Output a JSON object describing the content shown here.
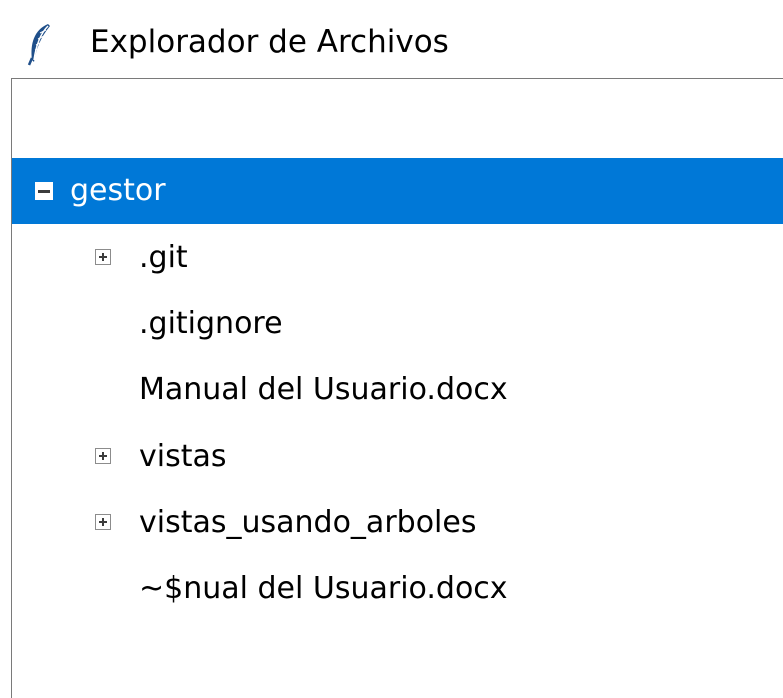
{
  "window": {
    "title": "Explorador de Archivos",
    "icon": "feather-icon"
  },
  "tree": {
    "root": {
      "label": "gestor",
      "expanded": true,
      "selected": true
    },
    "children": [
      {
        "label": ".git",
        "expandable": true
      },
      {
        "label": ".gitignore",
        "expandable": false
      },
      {
        "label": "Manual del Usuario.docx",
        "expandable": false
      },
      {
        "label": "vistas",
        "expandable": true
      },
      {
        "label": "vistas_usando_arboles",
        "expandable": true
      },
      {
        "label": "~$nual del Usuario.docx",
        "expandable": false
      }
    ]
  },
  "colors": {
    "selection": "#0078d7",
    "border": "#7a7a7a"
  }
}
